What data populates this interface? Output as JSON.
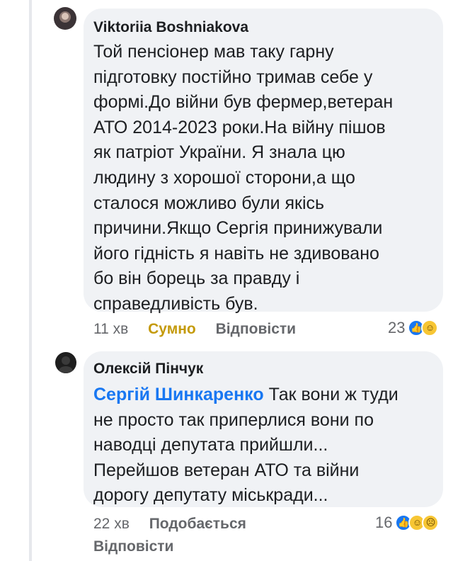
{
  "comments": [
    {
      "author": "Viktoriia Boshniakova",
      "text": "Той пенсіонер мав таку гарну\nпідготовку постійно тримав себе у\nформі.До війни був фермер,ветеран\nАТО 2014-2023 роки.На війну пішов\nяк патріот України. Я знала цю\nлюдину з хорошої сторони,а що\nсталося можливо були якісь\nпричини.Якщо Сергія принижували\nйого гідність я навіть не здивовано\nбо він борець за правду і\nсправедливість був.",
      "time": "11 хв",
      "reaction_label": "Сумно",
      "reply_label": "Відповісти",
      "reaction_count": "23",
      "reaction_icons": [
        "like-icon",
        "haha-icon"
      ]
    },
    {
      "author": "Олексій Пінчук",
      "mention": "Сергій Шинкаренко",
      "text_first_line": " Так вони ж туди",
      "text_rest": "не просто так приперлися вони по\nнаводці депутата прийшли...\nПерейшов ветеран АТО та війни\nдорогу депутату міськради...",
      "time": "22 хв",
      "reaction_label": "Подобається",
      "reply_label": "Відповісти",
      "reaction_count": "16",
      "reaction_icons": [
        "like-icon",
        "haha-icon",
        "sad-icon"
      ]
    }
  ],
  "colors": {
    "bubble": "#f0f2f5",
    "mention": "#1877f2",
    "reaction_active": "#c49a0a",
    "meta": "#65676b"
  }
}
